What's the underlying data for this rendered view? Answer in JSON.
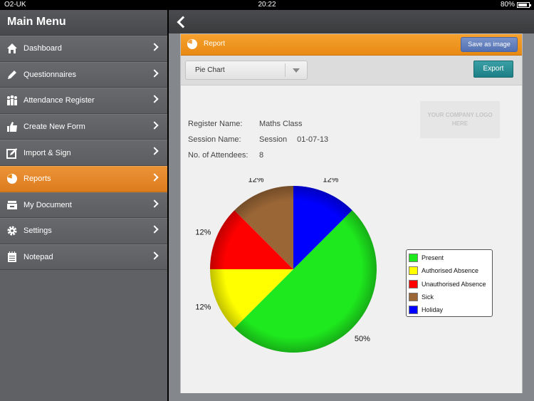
{
  "statusbar": {
    "carrier": "O2-UK",
    "time": "20:22",
    "battery": "80%"
  },
  "sidebar": {
    "title": "Main Menu",
    "items": [
      {
        "label": "Dashboard",
        "icon": "home-icon",
        "active": false
      },
      {
        "label": "Questionnaires",
        "icon": "pencil-icon",
        "active": false
      },
      {
        "label": "Attendance Register",
        "icon": "people-icon",
        "active": false
      },
      {
        "label": "Create New Form",
        "icon": "thumbs-up-icon",
        "active": false
      },
      {
        "label": "Import & Sign",
        "icon": "sign-icon",
        "active": false
      },
      {
        "label": "Reports",
        "icon": "pie-icon",
        "active": true
      },
      {
        "label": "My Document",
        "icon": "document-tray-icon",
        "active": false
      },
      {
        "label": "Settings",
        "icon": "gear-icon",
        "active": false
      },
      {
        "label": "Notepad",
        "icon": "notepad-icon",
        "active": false
      }
    ]
  },
  "panel": {
    "title": "Report",
    "save_label": "Save as image",
    "select_value": "Pie Chart",
    "export_label": "Export",
    "logo_text": "YOUR COMPANY LOGO HERE",
    "info": {
      "register_label": "Register Name:",
      "register_value": "Maths Class",
      "session_label": "Session Name:",
      "session_value": "Session",
      "session_date": "01-07-13",
      "attendees_label": "No. of Attendees:",
      "attendees_value": "8"
    }
  },
  "colors": {
    "accent": "#e88a14",
    "sidebar": "#5f6164",
    "export": "#1d7f86"
  },
  "chart_data": {
    "type": "pie",
    "slices": [
      {
        "name": "Present",
        "value": 50,
        "label": "50%",
        "color": "#1ee81e"
      },
      {
        "name": "Authorised Absence",
        "value": 12.5,
        "label": "12%",
        "color": "#ffff00"
      },
      {
        "name": "Unauthorised Absence",
        "value": 12.5,
        "label": "12%",
        "color": "#ff0000"
      },
      {
        "name": "Sick",
        "value": 12.5,
        "label": "12%",
        "color": "#9a6636"
      },
      {
        "name": "Holiday",
        "value": 12.5,
        "label": "12%",
        "color": "#0000ff"
      }
    ],
    "legend_position": "right"
  }
}
